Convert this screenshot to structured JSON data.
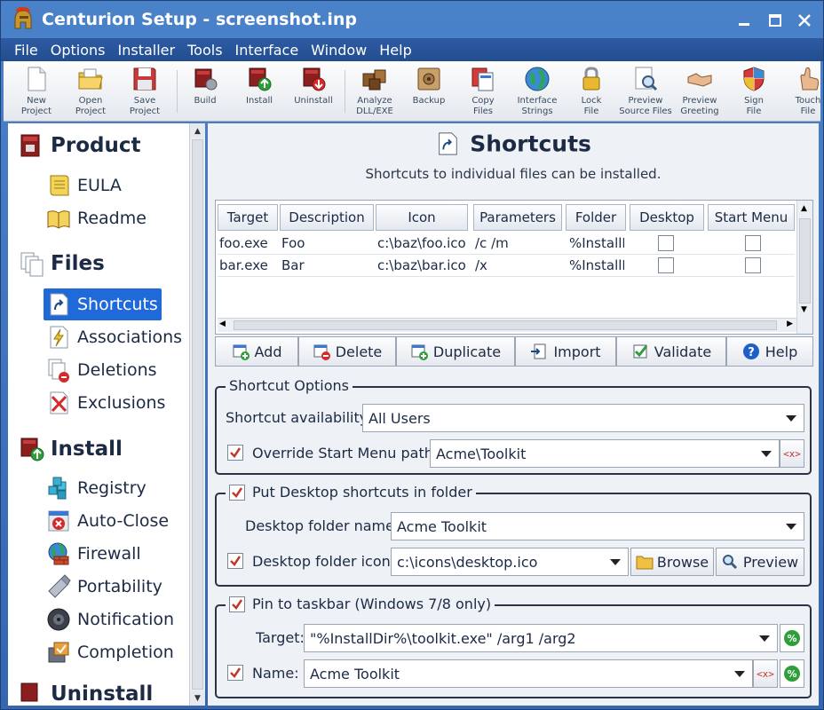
{
  "window": {
    "title": "Centurion Setup - screenshot.inp"
  },
  "menu": [
    "File",
    "Options",
    "Installer",
    "Tools",
    "Interface",
    "Window",
    "Help"
  ],
  "toolbar": [
    {
      "label": "New\nProject",
      "icon": "new-project-icon"
    },
    {
      "label": "Open\nProject",
      "icon": "open-project-icon"
    },
    {
      "label": "Save\nProject",
      "icon": "save-project-icon"
    },
    {
      "label": "Build",
      "icon": "build-icon"
    },
    {
      "label": "Install",
      "icon": "install-icon"
    },
    {
      "label": "Uninstall",
      "icon": "uninstall-icon"
    },
    {
      "label": "Analyze\nDLL/EXE",
      "icon": "analyze-icon"
    },
    {
      "label": "Backup",
      "icon": "backup-icon"
    },
    {
      "label": "Copy\nFiles",
      "icon": "copy-files-icon"
    },
    {
      "label": "Interface\nStrings",
      "icon": "interface-strings-icon"
    },
    {
      "label": "Lock\nFile",
      "icon": "lock-file-icon"
    },
    {
      "label": "Preview\nSource Files",
      "icon": "preview-source-icon"
    },
    {
      "label": "Preview\nGreeting",
      "icon": "preview-greeting-icon"
    },
    {
      "label": "Sign\nFile",
      "icon": "sign-file-icon"
    },
    {
      "label": "Touch\nFile",
      "icon": "touch-file-icon"
    }
  ],
  "sidebar": {
    "sections": [
      {
        "title": "Product",
        "icon": "product-icon",
        "items": [
          {
            "label": "EULA",
            "icon": "eula-icon"
          },
          {
            "label": "Readme",
            "icon": "readme-icon"
          }
        ]
      },
      {
        "title": "Files",
        "icon": "files-icon",
        "items": [
          {
            "label": "Shortcuts",
            "icon": "shortcuts-icon",
            "active": true
          },
          {
            "label": "Associations",
            "icon": "associations-icon"
          },
          {
            "label": "Deletions",
            "icon": "deletions-icon"
          },
          {
            "label": "Exclusions",
            "icon": "exclusions-icon"
          }
        ]
      },
      {
        "title": "Install",
        "icon": "install-section-icon",
        "items": [
          {
            "label": "Registry",
            "icon": "registry-icon"
          },
          {
            "label": "Auto-Close",
            "icon": "auto-close-icon"
          },
          {
            "label": "Firewall",
            "icon": "firewall-icon"
          },
          {
            "label": "Portability",
            "icon": "portability-icon"
          },
          {
            "label": "Notification",
            "icon": "notification-icon"
          },
          {
            "label": "Completion",
            "icon": "completion-icon"
          }
        ]
      },
      {
        "title": "Uninstall",
        "icon": "uninstall-section-icon",
        "items": []
      }
    ]
  },
  "page": {
    "title": "Shortcuts",
    "subtitle": "Shortcuts to individual files can be installed."
  },
  "table": {
    "columns": [
      "Target",
      "Description",
      "Icon",
      "Parameters",
      "Folder",
      "Desktop",
      "Start Menu"
    ],
    "rows": [
      {
        "target": "foo.exe",
        "description": "Foo",
        "icon": "c:\\baz\\foo.ico",
        "parameters": "/c /m",
        "folder": "%InstallD",
        "desktop": false,
        "start_menu": false
      },
      {
        "target": "bar.exe",
        "description": "Bar",
        "icon": "c:\\baz\\bar.ico",
        "parameters": "/x",
        "folder": "%InstallD",
        "desktop": false,
        "start_menu": false
      }
    ]
  },
  "table_buttons": {
    "add": "Add",
    "delete": "Delete",
    "duplicate": "Duplicate",
    "import": "Import",
    "validate": "Validate",
    "help": "Help"
  },
  "shortcut_options": {
    "legend": "Shortcut Options",
    "availability_label": "Shortcut availability:",
    "availability_value": "All Users",
    "override_label": "Override Start Menu path:",
    "override_checked": true,
    "override_value": "Acme\\Toolkit",
    "macro_button": "<x>"
  },
  "desktop_folder": {
    "legend": "Put Desktop shortcuts in folder",
    "checked": true,
    "name_label": "Desktop folder name:",
    "name_value": "Acme Toolkit",
    "icon_label": "Desktop folder icon:",
    "icon_checked": true,
    "icon_value": "c:\\icons\\desktop.ico",
    "browse": "Browse",
    "preview": "Preview"
  },
  "taskbar": {
    "legend": "Pin to taskbar (Windows 7/8 only)",
    "checked": true,
    "target_label": "Target:",
    "target_value": "\"%InstallDir%\\toolkit.exe\" /arg1 /arg2",
    "name_label": "Name:",
    "name_checked": true,
    "name_value": "Acme Toolkit",
    "macro_button": "<x>",
    "percent_button": "%"
  },
  "colors": {
    "title_bar": "#3d6fb8",
    "selection": "#1f69d9",
    "panel_bg": "#eef1f5"
  }
}
